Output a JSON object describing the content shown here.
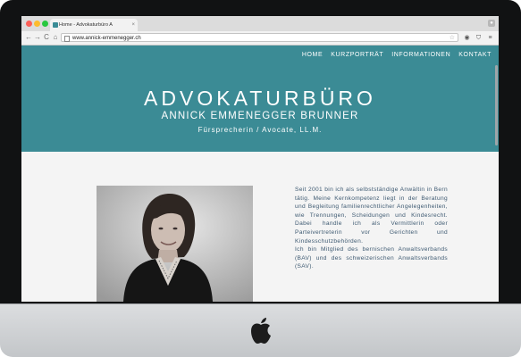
{
  "browser": {
    "tab_title": "Home - Advokaturbüro A",
    "tab_close": "×",
    "url": "www.annick-emmenegger.ch",
    "nav_back": "←",
    "nav_forward": "→",
    "nav_reload": "C",
    "nav_home": "⌂"
  },
  "site": {
    "nav": [
      "HOME",
      "KURZPORTRÄT",
      "INFORMATIONEN",
      "KONTAKT"
    ],
    "title": "ADVOKATURBÜRO",
    "subtitle": "ANNICK EMMENEGGER BRUNNER",
    "role": "Fürsprecherin / Avocate, LL.M.",
    "bio_paragraph_1": "Seit 2001 bin ich als selbstständige Anwältin in Bern tätig. Meine Kernkompetenz liegt in der Beratung und Begleitung familienrechtlicher Angelegenheiten, wie Trennungen, Scheidungen und Kindesrecht. Dabei handle ich als Vermittlerin oder Parteivertreterin vor Gerichten und Kindesschutzbehörden.",
    "bio_paragraph_2": "Ich bin Mitglied des bernischen Anwaltsverbands (BAV) und des schweizerischen Anwaltsverbands (SAV)."
  },
  "colors": {
    "accent": "#3b8b95",
    "bio_text": "#3e5a72"
  }
}
